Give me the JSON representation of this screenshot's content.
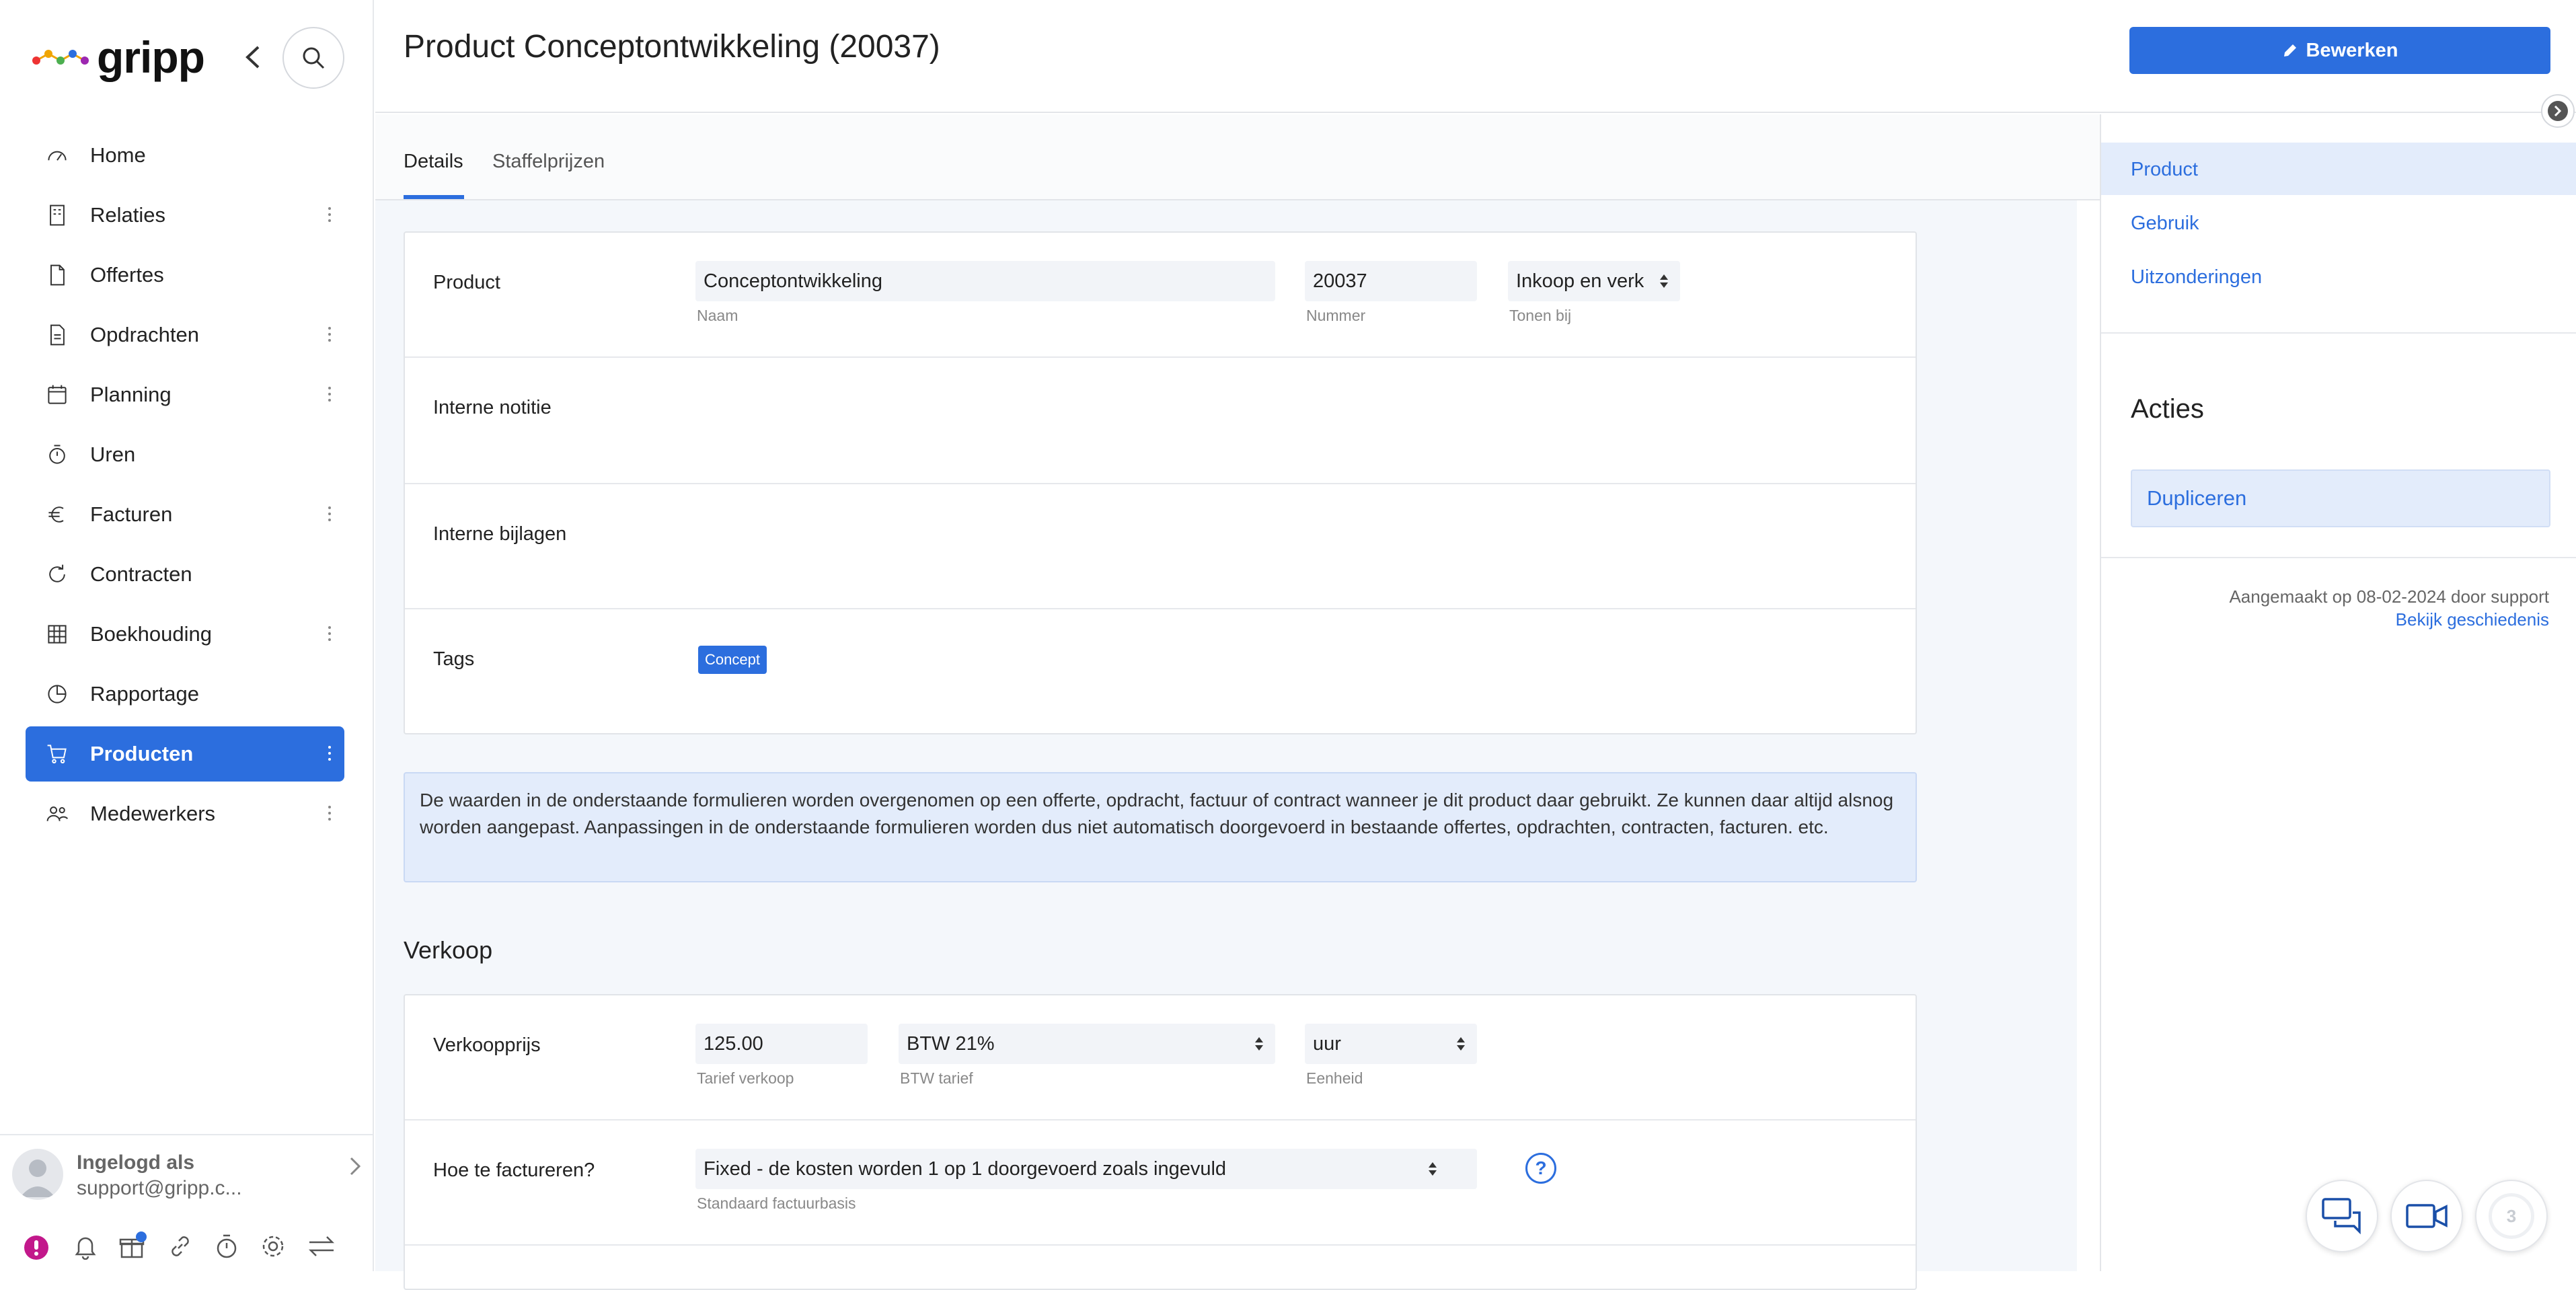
{
  "app": {
    "logo": "gripp"
  },
  "nav": {
    "items": [
      {
        "label": "Home",
        "icon": "dashboard-icon",
        "dots": false
      },
      {
        "label": "Relaties",
        "icon": "building-icon",
        "dots": true
      },
      {
        "label": "Offertes",
        "icon": "document-icon",
        "dots": false
      },
      {
        "label": "Opdrachten",
        "icon": "file-list-icon",
        "dots": true
      },
      {
        "label": "Planning",
        "icon": "calendar-icon",
        "dots": true
      },
      {
        "label": "Uren",
        "icon": "stopwatch-icon",
        "dots": false
      },
      {
        "label": "Facturen",
        "icon": "euro-icon",
        "dots": true
      },
      {
        "label": "Contracten",
        "icon": "refresh-icon",
        "dots": false
      },
      {
        "label": "Boekhouding",
        "icon": "grid-icon",
        "dots": true
      },
      {
        "label": "Rapportage",
        "icon": "pie-chart-icon",
        "dots": false
      },
      {
        "label": "Producten",
        "icon": "cart-icon",
        "dots": true,
        "active": true
      },
      {
        "label": "Medewerkers",
        "icon": "users-icon",
        "dots": true
      }
    ]
  },
  "user": {
    "title": "Ingelogd als",
    "email": "support@gripp.c..."
  },
  "header": {
    "title": "Product Conceptontwikkeling (20037)",
    "edit_label": "Bewerken"
  },
  "tabs": [
    {
      "label": "Details",
      "active": true
    },
    {
      "label": "Staffelprijzen"
    }
  ],
  "product_card": {
    "product_label": "Product",
    "name_value": "Conceptontwikkeling",
    "name_caption": "Naam",
    "number_value": "20037",
    "number_caption": "Nummer",
    "show_value": "Inkoop en verk",
    "show_caption": "Tonen bij",
    "note_label": "Interne notitie",
    "attachments_label": "Interne bijlagen",
    "tags_label": "Tags",
    "tag": "Concept"
  },
  "info_text": "De waarden in de onderstaande formulieren worden overgenomen op een offerte, opdracht, factuur of contract wanneer je dit product daar gebruikt. Ze kunnen daar altijd alsnog worden aangepast. Aanpassingen in de onderstaande formulieren worden dus niet automatisch doorgevoerd in bestaande offertes, opdrachten, contracten, facturen. etc.",
  "verkoop": {
    "heading": "Verkoop",
    "price_label": "Verkoopprijs",
    "price_value": "125.00",
    "price_caption": "Tarief verkoop",
    "vat_value": "BTW 21%",
    "vat_caption": "BTW tarief",
    "unit_value": "uur",
    "unit_caption": "Eenheid",
    "invoice_label": "Hoe te factureren?",
    "invoice_value": "Fixed - de kosten worden 1 op 1 doorgevoerd zoals ingevuld",
    "invoice_caption": "Standaard factuurbasis"
  },
  "right": {
    "links": [
      {
        "label": "Product",
        "active": true
      },
      {
        "label": "Gebruik"
      },
      {
        "label": "Uitzonderingen"
      }
    ],
    "actions_heading": "Acties",
    "duplicate_label": "Dupliceren",
    "created_text": "Aangemaakt op 08-02-2024 door support",
    "history_link": "Bekijk geschiedenis"
  },
  "chat": {
    "badge": "3"
  },
  "colors": {
    "accent": "#2c6ede",
    "background": "#f4f7fb",
    "highlight": "#e3ecfb"
  }
}
